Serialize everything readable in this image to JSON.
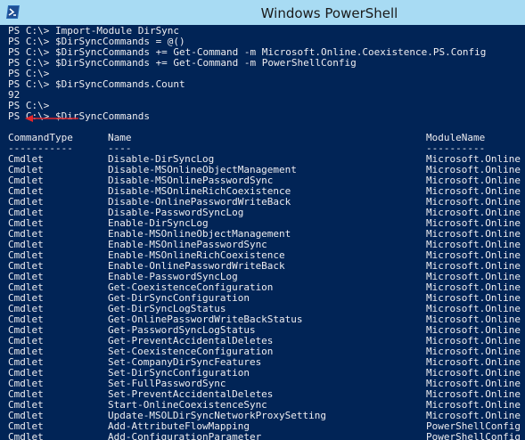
{
  "window": {
    "title": "Windows PowerShell",
    "icon": "powershell-icon"
  },
  "console": {
    "commands": [
      "PS C:\\> Import-Module DirSync",
      "PS C:\\> $DirSyncCommands = @()",
      "PS C:\\> $DirSyncCommands += Get-Command -m Microsoft.Online.Coexistence.PS.Config",
      "PS C:\\> $DirSyncCommands += Get-Command -m PowerShellConfig",
      "PS C:\\>",
      "PS C:\\> $DirSyncCommands.Count",
      "92",
      "PS C:\\>",
      "PS C:\\> $DirSyncCommands"
    ],
    "table": {
      "headers": [
        "CommandType",
        "Name",
        "ModuleName"
      ],
      "underlines": [
        "-----------",
        "----",
        "----------"
      ],
      "rows": [
        [
          "Cmdlet",
          "Disable-DirSyncLog",
          "Microsoft.Online"
        ],
        [
          "Cmdlet",
          "Disable-MSOnlineObjectManagement",
          "Microsoft.Online"
        ],
        [
          "Cmdlet",
          "Disable-MSOnlinePasswordSync",
          "Microsoft.Online"
        ],
        [
          "Cmdlet",
          "Disable-MSOnlineRichCoexistence",
          "Microsoft.Online"
        ],
        [
          "Cmdlet",
          "Disable-OnlinePasswordWriteBack",
          "Microsoft.Online"
        ],
        [
          "Cmdlet",
          "Disable-PasswordSyncLog",
          "Microsoft.Online"
        ],
        [
          "Cmdlet",
          "Enable-DirSyncLog",
          "Microsoft.Online"
        ],
        [
          "Cmdlet",
          "Enable-MSOnlineObjectManagement",
          "Microsoft.Online"
        ],
        [
          "Cmdlet",
          "Enable-MSOnlinePasswordSync",
          "Microsoft.Online"
        ],
        [
          "Cmdlet",
          "Enable-MSOnlineRichCoexistence",
          "Microsoft.Online"
        ],
        [
          "Cmdlet",
          "Enable-OnlinePasswordWriteBack",
          "Microsoft.Online"
        ],
        [
          "Cmdlet",
          "Enable-PasswordSyncLog",
          "Microsoft.Online"
        ],
        [
          "Cmdlet",
          "Get-CoexistenceConfiguration",
          "Microsoft.Online"
        ],
        [
          "Cmdlet",
          "Get-DirSyncConfiguration",
          "Microsoft.Online"
        ],
        [
          "Cmdlet",
          "Get-DirSyncLogStatus",
          "Microsoft.Online"
        ],
        [
          "Cmdlet",
          "Get-OnlinePasswordWriteBackStatus",
          "Microsoft.Online"
        ],
        [
          "Cmdlet",
          "Get-PasswordSyncLogStatus",
          "Microsoft.Online"
        ],
        [
          "Cmdlet",
          "Get-PreventAccidentalDeletes",
          "Microsoft.Online"
        ],
        [
          "Cmdlet",
          "Set-CoexistenceConfiguration",
          "Microsoft.Online"
        ],
        [
          "Cmdlet",
          "Set-CompanyDirSyncFeatures",
          "Microsoft.Online"
        ],
        [
          "Cmdlet",
          "Set-DirSyncConfiguration",
          "Microsoft.Online"
        ],
        [
          "Cmdlet",
          "Set-FullPasswordSync",
          "Microsoft.Online"
        ],
        [
          "Cmdlet",
          "Set-PreventAccidentalDeletes",
          "Microsoft.Online"
        ],
        [
          "Cmdlet",
          "Start-OnlineCoexistenceSync",
          "Microsoft.Online"
        ],
        [
          "Cmdlet",
          "Update-MSOLDirSyncNetworkProxySetting",
          "Microsoft.Online"
        ],
        [
          "Cmdlet",
          "Add-AttributeFlowMapping",
          "PowerShellConfig"
        ],
        [
          "Cmdlet",
          "Add-ConfigurationParameter",
          "PowerShellConfig"
        ]
      ]
    }
  },
  "colors": {
    "console_bg": "#012456",
    "console_fg": "#eeedf0",
    "titlebar": "#a8dbf3",
    "arrow": "#e0262b"
  }
}
